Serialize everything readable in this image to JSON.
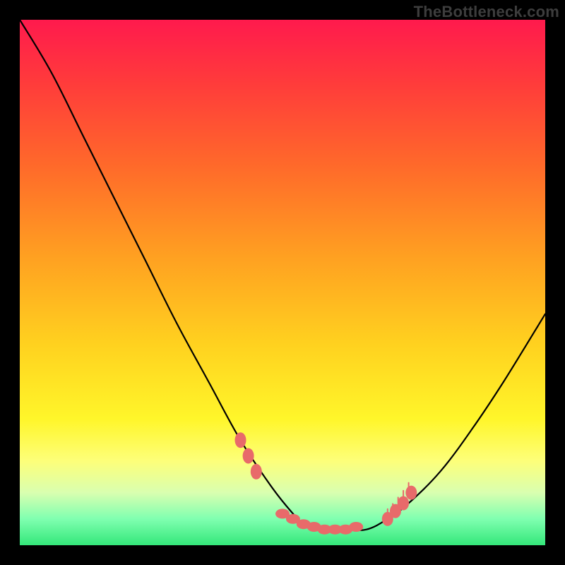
{
  "watermark": {
    "text": "TheBottleneck.com"
  },
  "gradient": {
    "top": "#ff1a4d",
    "mid_upper": "#ff6a2a",
    "mid": "#ffd21f",
    "mid_lower": "#fff62a",
    "bottom": "#34e77a"
  },
  "chart_data": {
    "type": "line",
    "title": "",
    "xlabel": "",
    "ylabel": "",
    "xlim": [
      0,
      100
    ],
    "ylim": [
      0,
      100
    ],
    "series": [
      {
        "name": "bottleneck-curve",
        "x": [
          0,
          6,
          12,
          18,
          24,
          30,
          36,
          42,
          48,
          52,
          54,
          58,
          62,
          66,
          70,
          74,
          80,
          86,
          92,
          100
        ],
        "values": [
          100,
          90,
          78,
          66,
          54,
          42,
          31,
          20,
          11,
          6,
          4,
          3,
          3,
          3,
          5,
          8,
          14,
          22,
          31,
          44
        ]
      }
    ],
    "markers": {
      "color": "#e86a6a",
      "left_cluster_x": [
        42,
        43.5,
        45
      ],
      "left_cluster_y": [
        20,
        17,
        14
      ],
      "bottom_cluster_x": [
        50,
        52,
        54,
        56,
        58,
        60,
        62,
        64
      ],
      "bottom_cluster_y": [
        6,
        5,
        4,
        3.5,
        3,
        3,
        3,
        3.5
      ],
      "right_cluster_x": [
        70,
        71.5,
        73,
        74.5
      ],
      "right_cluster_y": [
        5,
        6.5,
        8,
        10
      ],
      "right_ticks_x": [
        70,
        71,
        72,
        73,
        74
      ],
      "right_ticks_y": [
        5,
        6,
        7.2,
        8.5,
        10
      ]
    }
  }
}
